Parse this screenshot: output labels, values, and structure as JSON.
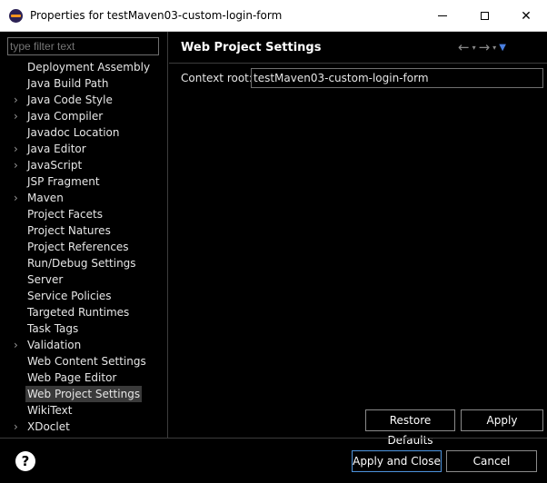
{
  "window": {
    "title": "Properties for testMaven03-custom-login-form",
    "minimize_glyph": "",
    "close_glyph": "✕"
  },
  "filter": {
    "placeholder": "type filter text"
  },
  "tree": [
    {
      "label": "Deployment Assembly",
      "expandable": false
    },
    {
      "label": "Java Build Path",
      "expandable": false
    },
    {
      "label": "Java Code Style",
      "expandable": true
    },
    {
      "label": "Java Compiler",
      "expandable": true
    },
    {
      "label": "Javadoc Location",
      "expandable": false
    },
    {
      "label": "Java Editor",
      "expandable": true
    },
    {
      "label": "JavaScript",
      "expandable": true
    },
    {
      "label": "JSP Fragment",
      "expandable": false
    },
    {
      "label": "Maven",
      "expandable": true
    },
    {
      "label": "Project Facets",
      "expandable": false
    },
    {
      "label": "Project Natures",
      "expandable": false
    },
    {
      "label": "Project References",
      "expandable": false
    },
    {
      "label": "Run/Debug Settings",
      "expandable": false
    },
    {
      "label": "Server",
      "expandable": false
    },
    {
      "label": "Service Policies",
      "expandable": false
    },
    {
      "label": "Targeted Runtimes",
      "expandable": false
    },
    {
      "label": "Task Tags",
      "expandable": false
    },
    {
      "label": "Validation",
      "expandable": true
    },
    {
      "label": "Web Content Settings",
      "expandable": false
    },
    {
      "label": "Web Page Editor",
      "expandable": false
    },
    {
      "label": "Web Project Settings",
      "expandable": false,
      "selected": true
    },
    {
      "label": "WikiText",
      "expandable": false
    },
    {
      "label": "XDoclet",
      "expandable": true
    }
  ],
  "page": {
    "title": "Web Project Settings",
    "context_root_label": "Context root:",
    "context_root_value": "testMaven03-custom-login-form"
  },
  "buttons": {
    "restore_defaults": "Restore Defaults",
    "apply": "Apply",
    "apply_and_close": "Apply and Close",
    "cancel": "Cancel",
    "help": "?"
  },
  "colors": {
    "background": "#000000",
    "selection": "#3a3a3a",
    "focus_border": "#4a90d9",
    "menu_arrow": "#4a7fe0"
  }
}
